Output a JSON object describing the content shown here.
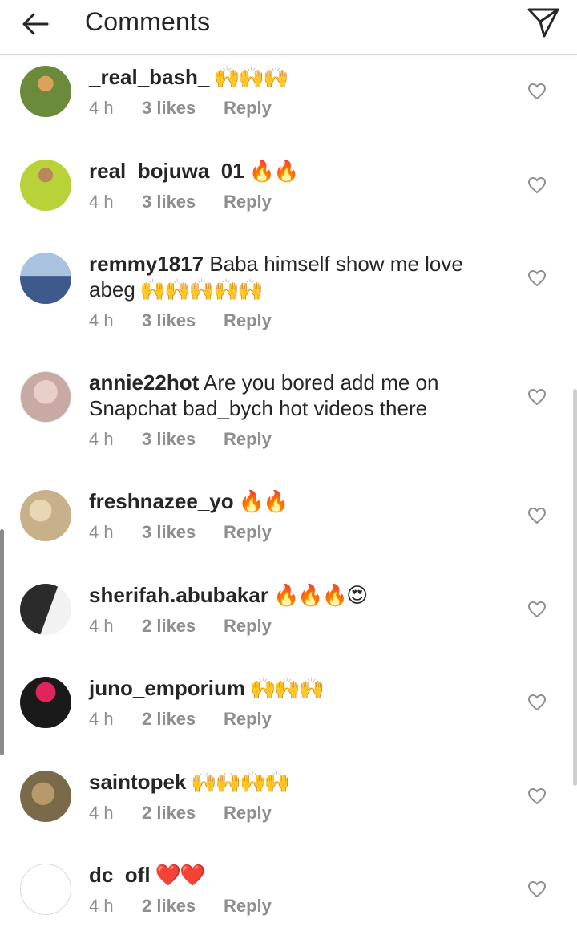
{
  "header": {
    "title": "Comments"
  },
  "comments": [
    {
      "username": "_real_bash_",
      "text": "",
      "emoji": "🙌🙌🙌",
      "time": "4 h",
      "likes": "3 likes",
      "reply": "Reply",
      "avatar_color": "#6b8a3c"
    },
    {
      "username": "real_bojuwa_01",
      "text": "",
      "emoji": "🔥🔥",
      "time": "4 h",
      "likes": "3 likes",
      "reply": "Reply",
      "avatar_color": "#b9d23a"
    },
    {
      "username": "remmy1817",
      "text": " Baba himself show me love abeg",
      "emoji": "🙌🙌🙌🙌🙌",
      "time": "4 h",
      "likes": "3 likes",
      "reply": "Reply",
      "avatar_color": "#3e5a8c"
    },
    {
      "username": "annie22hot",
      "text": " Are you bored add me on Snapchat bad_bych hot videos there",
      "emoji": "",
      "time": "4 h",
      "likes": "3 likes",
      "reply": "Reply",
      "avatar_color": "#c9a9a4"
    },
    {
      "username": "freshnazee_yo",
      "text": "",
      "emoji": "🔥🔥",
      "time": "4 h",
      "likes": "3 likes",
      "reply": "Reply",
      "avatar_color": "#c8b08a"
    },
    {
      "username": "sherifah.abubakar",
      "text": "",
      "emoji": "🔥🔥🔥😍",
      "time": "4 h",
      "likes": "2 likes",
      "reply": "Reply",
      "avatar_color": "#2b2b2b"
    },
    {
      "username": "juno_emporium",
      "text": "",
      "emoji": "🙌🙌🙌",
      "time": "4 h",
      "likes": "2 likes",
      "reply": "Reply",
      "avatar_color": "#1a1a1a"
    },
    {
      "username": "saintopek",
      "text": "",
      "emoji": "🙌🙌🙌🙌",
      "time": "4 h",
      "likes": "2 likes",
      "reply": "Reply",
      "avatar_color": "#7a6a4a"
    },
    {
      "username": "dc_ofl",
      "text": "",
      "emoji": "❤️❤️",
      "time": "4 h",
      "likes": "2 likes",
      "reply": "Reply",
      "avatar_color": "#ffffff"
    }
  ]
}
